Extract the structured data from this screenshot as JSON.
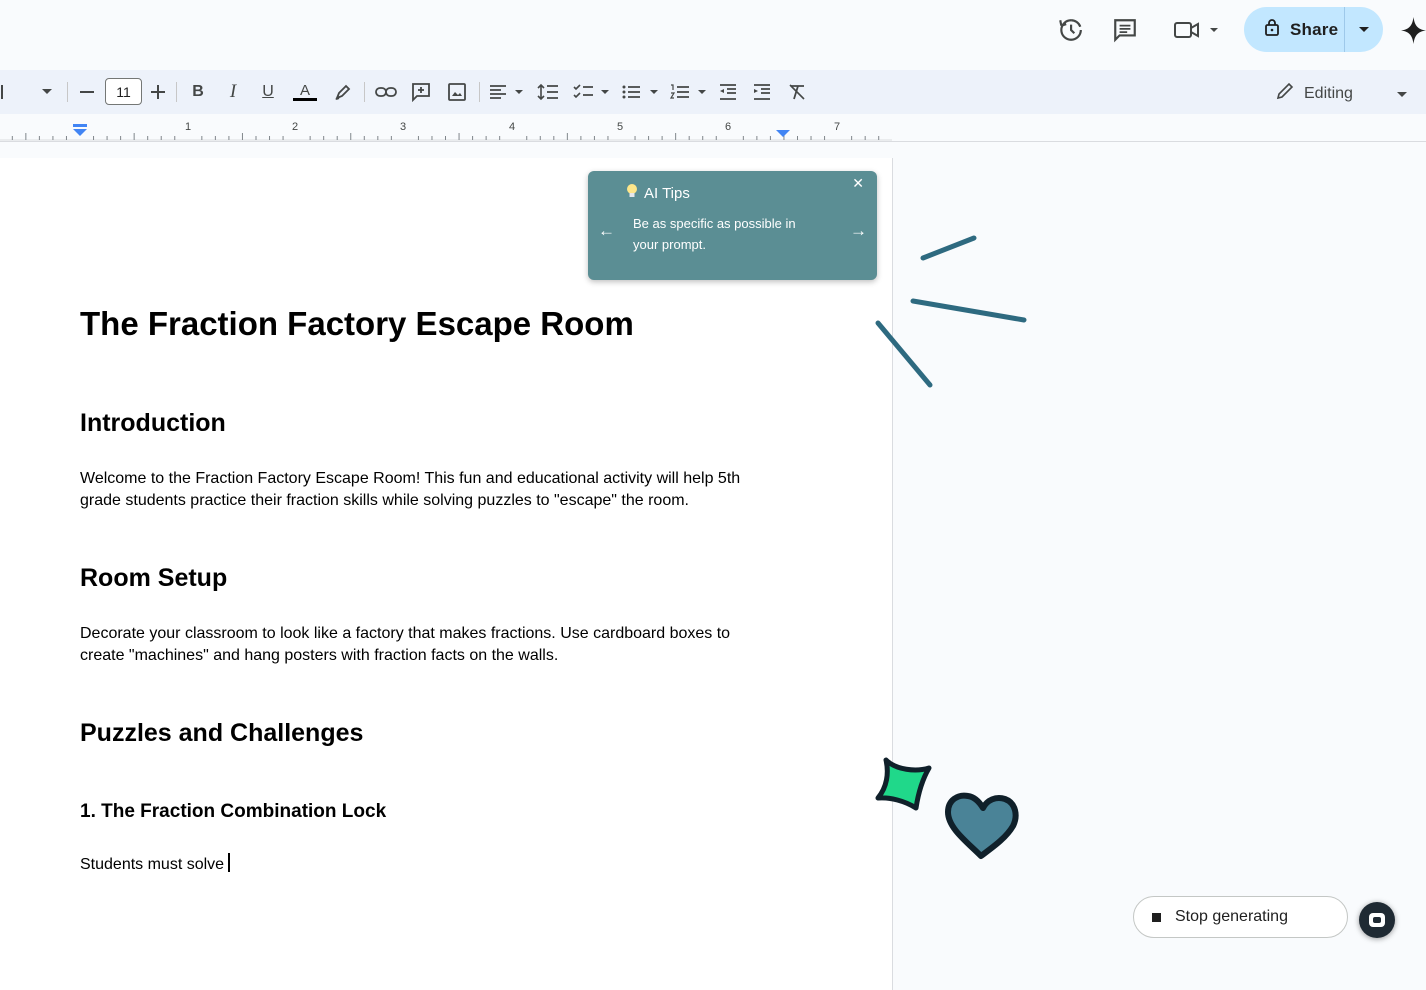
{
  "header": {
    "share_label": "Share",
    "icons": [
      "history-icon",
      "comment-icon",
      "meet-video-icon",
      "lock-icon",
      "gemini-star-icon"
    ]
  },
  "toolbar": {
    "font_size": "11",
    "mode_label": "Editing",
    "text_color": "#000000"
  },
  "ruler": {
    "numbers": [
      "1",
      "2",
      "3",
      "4",
      "5",
      "6",
      "7"
    ]
  },
  "tips": {
    "title": "AI Tips",
    "body": "Be as specific as possible in your prompt."
  },
  "document": {
    "title": "The Fraction Factory Escape Room",
    "intro_heading": "Introduction",
    "intro_text": "Welcome to the Fraction Factory Escape Room! This fun and educational activity will help 5th grade students practice their fraction skills while solving puzzles to \"escape\" the room.",
    "setup_heading": "Room Setup",
    "setup_text": "Decorate your classroom to look like a factory that makes fractions. Use cardboard boxes to create \"machines\" and hang posters with fraction facts on the walls.",
    "puzzles_heading": "Puzzles and Challenges",
    "puzzle1_heading": "1. The Fraction Combination Lock",
    "puzzle1_text": "Students must solve"
  },
  "generation": {
    "stop_label": "Stop generating"
  },
  "colors": {
    "accent": "#c2e7ff",
    "tips_bg": "#5b8e94",
    "deco_teal": "#2e6a80",
    "deco_green": "#20d88a"
  }
}
